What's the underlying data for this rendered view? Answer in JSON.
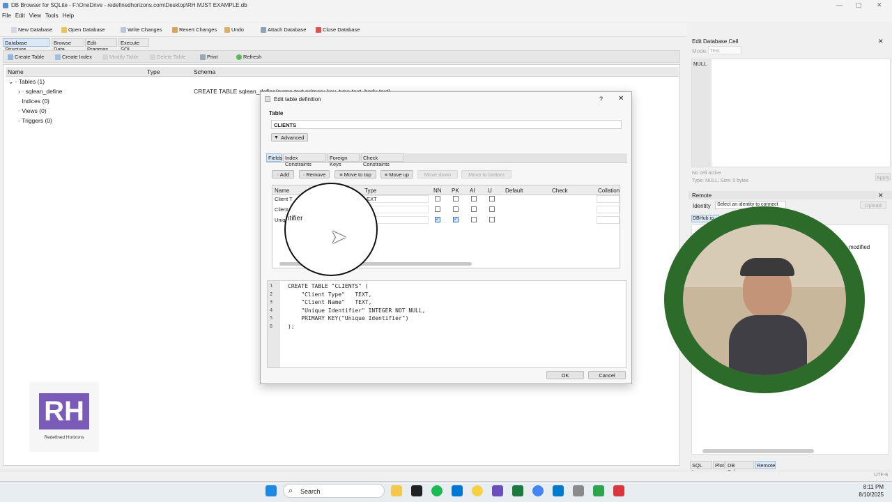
{
  "window": {
    "title": "DB Browser for SQLite - F:\\OneDrive - redefinedhorizons.com\\Desktop\\RH MJST EXAMPLE.db",
    "controls": [
      "—",
      "▢",
      "✕"
    ]
  },
  "menu": [
    "File",
    "Edit",
    "View",
    "Tools",
    "Help"
  ],
  "toolbar": {
    "new_db": "New Database",
    "open_db": "Open Database",
    "write": "Write Changes",
    "revert": "Revert Changes",
    "undo": "Undo",
    "attach": "Attach Database",
    "close": "Close Database"
  },
  "main_tabs": [
    "Database Structure",
    "Browse Data",
    "Edit Pragmas",
    "Execute SQL"
  ],
  "structure_tools": {
    "create_table": "Create Table",
    "create_index": "Create Index",
    "modify_table": "Modify Table",
    "delete_table": "Delete Table",
    "print": "Print",
    "refresh": "Refresh"
  },
  "grid_headers": [
    "Name",
    "Type",
    "Schema"
  ],
  "tree": {
    "tables": "Tables (1)",
    "table1": "sqlean_define",
    "schema1": "CREATE TABLE sqlean_define(name text primary key, type text, body text)",
    "indices": "Indices (0)",
    "views": "Views (0)",
    "triggers": "Triggers (0)"
  },
  "dialog": {
    "title": "Edit table definition",
    "help": "?",
    "close": "✕",
    "table_label": "Table",
    "table_name": "CLIENTS",
    "advanced": "Advanced",
    "tabs": [
      "Fields",
      "Index Constraints",
      "Foreign Keys",
      "Check Constraints"
    ],
    "buttons": {
      "add": "Add",
      "remove": "Remove",
      "move_top": "Move to top",
      "move_up": "Move up",
      "move_down": "Move down",
      "move_bottom": "Move to bottom"
    },
    "columns": [
      "Name",
      "Type",
      "NN",
      "PK",
      "AI",
      "U",
      "Default",
      "Check",
      "Collation"
    ],
    "rows": [
      {
        "name": "Client T",
        "type": "EXT",
        "nn": false,
        "pk": false,
        "ai": false,
        "u": false
      },
      {
        "name": "Client",
        "type": "",
        "nn": false,
        "pk": false,
        "ai": false,
        "u": false
      },
      {
        "name": "Uniq",
        "type": "ER",
        "nn": true,
        "pk": true,
        "ai": false,
        "u": false
      }
    ],
    "magnified_text": "ntifier",
    "sql_lines": [
      {
        "n": "1",
        "text": "CREATE TABLE \"CLIENTS\" ("
      },
      {
        "n": "2",
        "text": "    \"Client Type\"   TEXT,"
      },
      {
        "n": "3",
        "text": "    \"Client Name\"   TEXT,"
      },
      {
        "n": "4",
        "text": "    \"Unique Identifier\" INTEGER NOT NULL,"
      },
      {
        "n": "5",
        "text": "    PRIMARY KEY(\"Unique Identifier\")"
      },
      {
        "n": "6",
        "text": ");"
      }
    ],
    "ok": "OK",
    "cancel": "Cancel"
  },
  "edit_cell": {
    "title": "Edit Database Cell",
    "mode_label": "Mode:",
    "mode_value": "Text",
    "null": "NULL",
    "status1": "No cell active.",
    "status2": "Type: NULL; Size: 0 bytes",
    "apply": "Apply"
  },
  "remote": {
    "title": "Remote",
    "identity_label": "Identity",
    "identity_value": "Select an identity to connect",
    "upload": "Upload",
    "tab": "DBHub.io",
    "col_modified": "modified"
  },
  "bottom_tabs": [
    "SQL Log",
    "Plot",
    "DB Schema",
    "Remote"
  ],
  "status_right": "UTF-8",
  "logo": {
    "letters": "RH",
    "caption": "Redefined Horizons"
  },
  "taskbar": {
    "search": "Search",
    "time": "8:11 PM",
    "date": "8/10/2025"
  }
}
